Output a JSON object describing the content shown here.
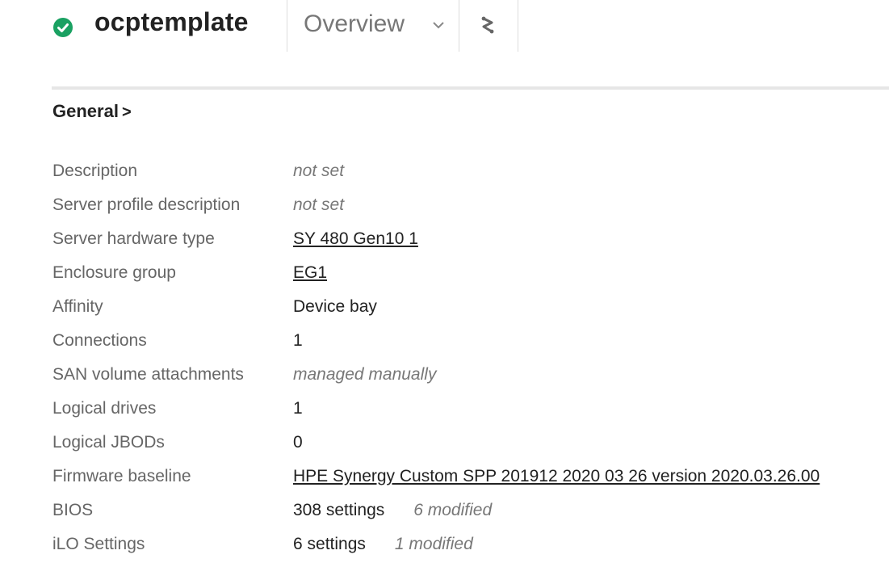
{
  "header": {
    "title": "ocptemplate",
    "view_label": "Overview"
  },
  "colors": {
    "status_ok": "#1aa162",
    "text_primary": "#222222",
    "text_label": "#666666",
    "text_muted": "#777777"
  },
  "icons": {
    "status": "check-circle-icon",
    "view_menu": "chevron-down-icon",
    "map": "map-icon"
  },
  "section": {
    "title": "General",
    "arrow": ">"
  },
  "properties": [
    {
      "label": "Description",
      "value": "not set"
    },
    {
      "label": "Server profile description",
      "value": "not set"
    },
    {
      "label": "Server hardware type",
      "value": "SY 480 Gen10 1"
    },
    {
      "label": "Enclosure group",
      "value": "EG1"
    },
    {
      "label": "Affinity",
      "value": "Device bay"
    },
    {
      "label": "Connections",
      "value": "1"
    },
    {
      "label": "SAN volume attachments",
      "value": "managed manually"
    },
    {
      "label": "Logical drives",
      "value": "1"
    },
    {
      "label": "Logical JBODs",
      "value": "0"
    },
    {
      "label": "Firmware baseline",
      "value": "HPE Synergy Custom SPP 201912 2020 03 26 version 2020.03.26.00"
    },
    {
      "label": "BIOS",
      "value": "308 settings",
      "modified": "6 modified"
    },
    {
      "label": "iLO Settings",
      "value": "6 settings",
      "modified": "1 modified"
    }
  ]
}
